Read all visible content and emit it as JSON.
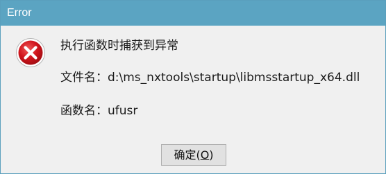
{
  "window": {
    "title": "Error"
  },
  "message": {
    "icon": "error-icon",
    "line1": "执行函数时捕获到异常",
    "file_label": "文件名：",
    "file_value": "d:\\ms_nxtools\\startup\\libmsstartup_x64.dll",
    "function_label": "函数名：",
    "function_value": "ufusr"
  },
  "buttons": {
    "ok_label": "确定(",
    "ok_mnemonic": "O",
    "ok_label_end": ")"
  },
  "colors": {
    "titlebar": "#5ba4c2",
    "border": "#5a9fbd",
    "content_bg": "#f0f0f0",
    "icon_red": "#c8161d"
  }
}
